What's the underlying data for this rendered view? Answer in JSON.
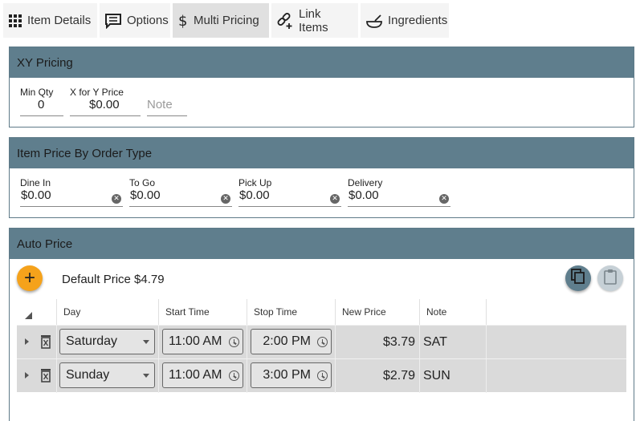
{
  "tabs": [
    {
      "label": "Item Details",
      "icon": "grid-icon"
    },
    {
      "label": "Options",
      "icon": "comment-list-icon"
    },
    {
      "label": "Multi Pricing",
      "icon": "dollar-icon",
      "active": true
    },
    {
      "label": "Link Items",
      "icon": "link-plus-icon"
    },
    {
      "label": "Ingredients",
      "icon": "bowl-icon"
    }
  ],
  "xy_pricing": {
    "title": "XY Pricing",
    "min_qty_label": "Min Qty",
    "min_qty_value": "0",
    "x_for_y_label": "X for Y Price",
    "x_for_y_value": "$0.00",
    "note_placeholder": "Note"
  },
  "order_type": {
    "title": "Item Price By Order Type",
    "fields": [
      {
        "label": "Dine In",
        "value": "$0.00"
      },
      {
        "label": "To Go",
        "value": "$0.00"
      },
      {
        "label": "Pick Up",
        "value": "$0.00"
      },
      {
        "label": "Delivery",
        "value": "$0.00"
      }
    ]
  },
  "auto_price": {
    "title": "Auto Price",
    "default_price": "Default Price $4.79",
    "columns": {
      "day": "Day",
      "start": "Start Time",
      "stop": "Stop Time",
      "new_price": "New Price",
      "note": "Note"
    },
    "rows": [
      {
        "day": "Saturday",
        "start": "11:00 AM",
        "stop": "2:00 PM",
        "new_price": "$3.79",
        "note": "SAT"
      },
      {
        "day": "Sunday",
        "start": "11:00 AM",
        "stop": "3:00 PM",
        "new_price": "$2.79",
        "note": "SUN"
      }
    ]
  },
  "colors": {
    "header": "#5f7e8d",
    "accent": "#f5a21b",
    "row": "#dadada"
  }
}
